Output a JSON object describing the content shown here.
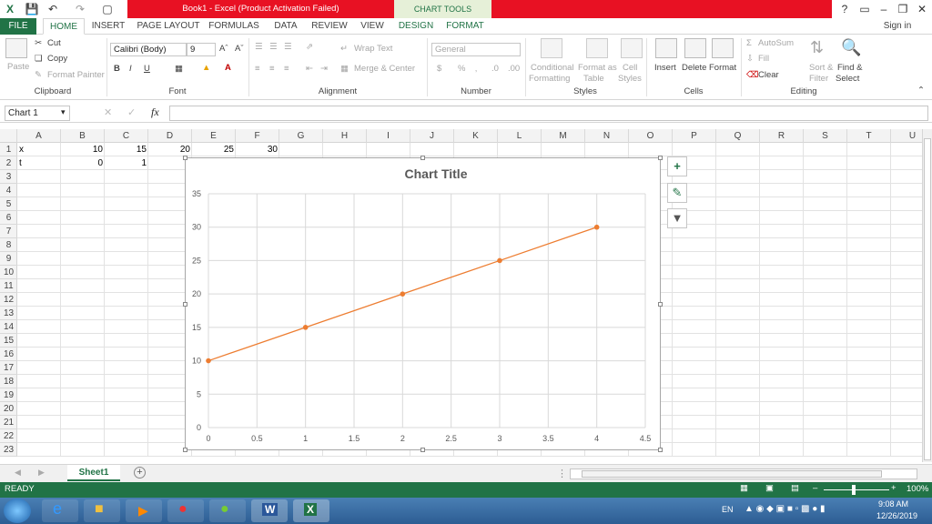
{
  "titlebar": {
    "title": "Book1 -  Excel (Product Activation Failed)",
    "chart_tools": "CHART TOOLS",
    "help": "?"
  },
  "tabs": [
    "FILE",
    "HOME",
    "INSERT",
    "PAGE LAYOUT",
    "FORMULAS",
    "DATA",
    "REVIEW",
    "VIEW",
    "DESIGN",
    "FORMAT"
  ],
  "sign_in": "Sign in",
  "ribbon": {
    "clipboard": {
      "paste": "Paste",
      "cut": "Cut",
      "copy": "Copy",
      "format_painter": "Format Painter",
      "label": "Clipboard"
    },
    "font": {
      "name": "Calibri (Body)",
      "size": "9",
      "label": "Font",
      "bold": "B",
      "italic": "I",
      "underline": "U"
    },
    "alignment": {
      "wrap": "Wrap Text",
      "merge": "Merge & Center",
      "label": "Alignment"
    },
    "number": {
      "format": "General",
      "label": "Number"
    },
    "styles": {
      "cond": [
        "Conditional",
        "Formatting"
      ],
      "table": [
        "Format as",
        "Table"
      ],
      "cell": [
        "Cell",
        "Styles"
      ],
      "label": "Styles"
    },
    "cells": {
      "insert": "Insert",
      "delete": "Delete",
      "format": "Format",
      "label": "Cells"
    },
    "editing": {
      "autosum": "AutoSum",
      "fill": "Fill",
      "clear": "Clear",
      "sort": [
        "Sort &",
        "Filter"
      ],
      "find": [
        "Find &",
        "Select"
      ],
      "label": "Editing"
    }
  },
  "namebox": "Chart 1",
  "fx": "fx",
  "columns": [
    "A",
    "B",
    "C",
    "D",
    "E",
    "F",
    "G",
    "H",
    "I",
    "J",
    "K",
    "L",
    "M",
    "N",
    "O",
    "P",
    "Q",
    "R",
    "S",
    "T",
    "U"
  ],
  "rows": [
    "1",
    "2",
    "3",
    "4",
    "5",
    "6",
    "7",
    "8",
    "9",
    "10",
    "11",
    "12",
    "13",
    "14",
    "15",
    "16",
    "17",
    "18",
    "19",
    "20",
    "21",
    "22",
    "23"
  ],
  "cells": {
    "a1": "x",
    "b1": "10",
    "c1": "15",
    "d1": "20",
    "e1": "25",
    "f1": "30",
    "a2": "t",
    "b2": "0",
    "c2": "1"
  },
  "chart_data": {
    "type": "scatter",
    "title": "Chart Title",
    "x": [
      0,
      1,
      2,
      3,
      4
    ],
    "y": [
      10,
      15,
      20,
      25,
      30
    ],
    "xlim": [
      0,
      4.5
    ],
    "ylim": [
      0,
      35
    ],
    "xticks": [
      "0",
      "0.5",
      "1",
      "1.5",
      "2",
      "2.5",
      "3",
      "3.5",
      "4",
      "4.5"
    ],
    "yticks": [
      "0",
      "5",
      "10",
      "15",
      "20",
      "25",
      "30",
      "35"
    ],
    "grid": true,
    "color": "#ed7d31"
  },
  "sheet_tab": "Sheet1",
  "status": {
    "ready": "READY",
    "zoom": "100%"
  },
  "taskbar": {
    "lang": "EN",
    "time": "9:08 AM",
    "date": "12/26/2019"
  },
  "colors": {
    "excel_green": "#217346",
    "title_red": "#e81123"
  }
}
